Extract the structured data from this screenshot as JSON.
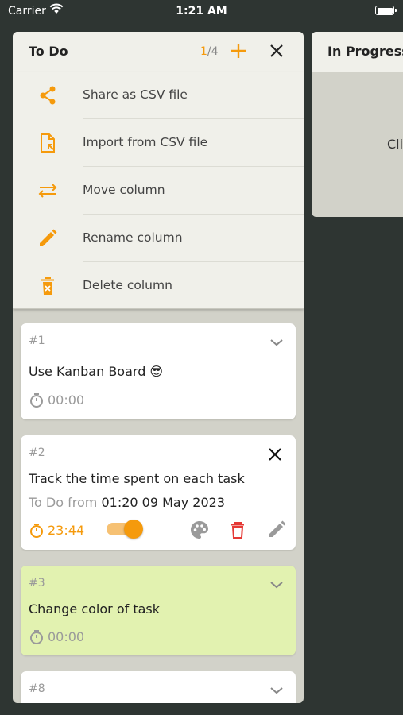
{
  "status_bar": {
    "carrier": "Carrier",
    "time": "1:21 AM"
  },
  "column": {
    "title": "To Do",
    "count_current": "1",
    "count_total": "/4",
    "menu": [
      {
        "icon": "share-icon",
        "label": "Share as CSV file"
      },
      {
        "icon": "import-file-icon",
        "label": "Import from CSV file"
      },
      {
        "icon": "swap-arrows-icon",
        "label": "Move column"
      },
      {
        "icon": "pencil-icon",
        "label": "Rename column"
      },
      {
        "icon": "delete-icon",
        "label": "Delete column"
      }
    ],
    "tasks": [
      {
        "number": "#1",
        "title": "Use Kanban Board 😎",
        "timer": "00:00",
        "color": "#ffffff"
      },
      {
        "number": "#2",
        "title": "Track the time spent on each task",
        "status": "To Do",
        "status_from": "from",
        "status_date": "01:20 09 May 2023",
        "timer": "23:44",
        "color": "#ffffff",
        "timer_running": true
      },
      {
        "number": "#3",
        "title": "Change color of task",
        "timer": "00:00",
        "color": "#e2f2b0"
      },
      {
        "number": "#8"
      }
    ]
  },
  "column2": {
    "title": "In Progress",
    "hint_partial": "Cli"
  },
  "colors": {
    "accent": "#f59a0c",
    "delete": "#e53935",
    "background": "#2e3532",
    "column_bg": "#d2d2c9",
    "header_bg": "#f0f0ea"
  }
}
